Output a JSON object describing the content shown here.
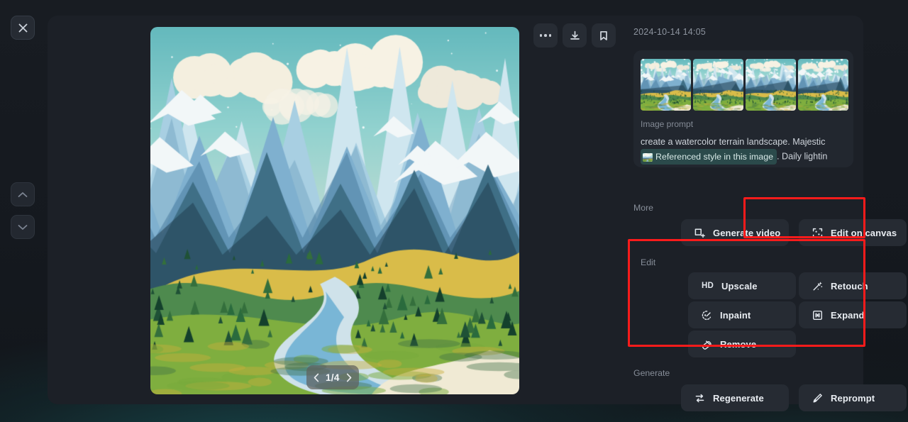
{
  "window": {
    "background_color": "#15191f",
    "panel_color": "#1c2027",
    "accent_color": "#2b4a4b",
    "annotation_color": "#fb1b1b"
  },
  "rail": {
    "close_label": "Close",
    "prev_label": "Previous",
    "next_label": "Next"
  },
  "toolbar": {
    "more_label": "More options",
    "download_label": "Download",
    "bookmark_label": "Save"
  },
  "hero": {
    "alt": "Watercolor terrain landscape with mountains, forests and a winding river",
    "pager": {
      "current": 1,
      "total": 4,
      "text": "1/4",
      "prev": "‹",
      "next": "›"
    }
  },
  "sidebar": {
    "timestamp": "2024-10-14 14:05",
    "prompt": {
      "label": "Image prompt",
      "text_before": "create a watercolor terrain landscape. Majestic ",
      "chip_label": "Referenced style in this image",
      "text_after": ". Daily lightin",
      "full_text": "create a watercolor terrain landscape. Majestic Referenced style in this image . Daily lightin",
      "thumbnail_count": 4
    },
    "sections": [
      {
        "title": "More",
        "buttons": [
          {
            "label": "Generate video",
            "icon": "video-frame-icon"
          },
          {
            "label": "Edit on canvas",
            "icon": "canvas-crop-icon",
            "highlighted": true
          }
        ]
      },
      {
        "title": "Edit",
        "highlighted": true,
        "buttons": [
          {
            "label": "Upscale",
            "icon": "hd-icon"
          },
          {
            "label": "Retouch",
            "icon": "magic-wand-icon"
          },
          {
            "label": "Inpaint",
            "icon": "paint-brush-icon"
          },
          {
            "label": "Expand",
            "icon": "expand-square-icon"
          },
          {
            "label": "Remove",
            "icon": "eraser-icon"
          }
        ]
      },
      {
        "title": "Generate",
        "buttons": [
          {
            "label": "Regenerate",
            "icon": "refresh-arrows-icon"
          },
          {
            "label": "Reprompt",
            "icon": "pencil-icon"
          }
        ]
      }
    ]
  }
}
